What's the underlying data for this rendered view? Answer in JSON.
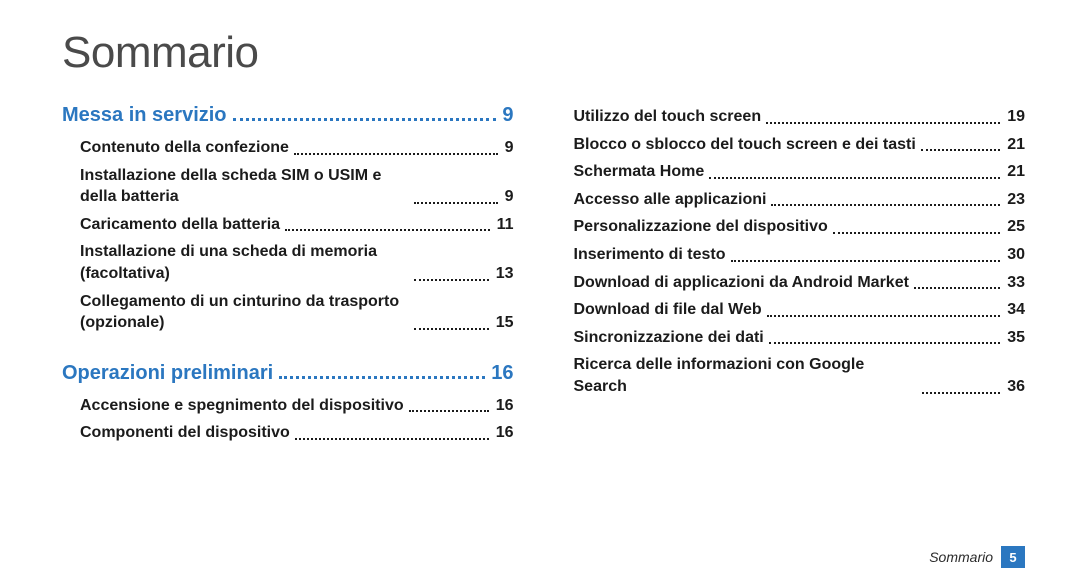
{
  "title": "Sommario",
  "sections": [
    {
      "label": "Messa in servizio",
      "page": "9"
    },
    {
      "label": "Operazioni preliminari",
      "page": "16"
    }
  ],
  "leftEntries": {
    "s0": [
      {
        "label": "Contenuto della confezione",
        "page": "9"
      },
      {
        "label": "Installazione della scheda SIM o USIM e della batteria",
        "page": "9"
      },
      {
        "label": "Caricamento della batteria",
        "page": "11"
      },
      {
        "label": "Installazione di una scheda di memoria (facoltativa)",
        "page": "13"
      },
      {
        "label": "Collegamento di un cinturino da trasporto (opzionale)",
        "page": "15"
      }
    ],
    "s1": [
      {
        "label": "Accensione e spegnimento del dispositivo",
        "page": "16"
      },
      {
        "label": "Componenti del dispositivo",
        "page": "16"
      }
    ]
  },
  "rightEntries": [
    {
      "label": "Utilizzo del touch screen",
      "page": "19"
    },
    {
      "label": "Blocco o sblocco del touch screen e dei tasti",
      "page": "21"
    },
    {
      "label": "Schermata Home",
      "page": "21"
    },
    {
      "label": "Accesso alle applicazioni",
      "page": "23"
    },
    {
      "label": "Personalizzazione del dispositivo",
      "page": "25"
    },
    {
      "label": "Inserimento di testo",
      "page": "30"
    },
    {
      "label": "Download di applicazioni da Android Market",
      "page": "33"
    },
    {
      "label": "Download di file dal Web",
      "page": "34"
    },
    {
      "label": "Sincronizzazione dei dati",
      "page": "35"
    },
    {
      "label": "Ricerca delle informazioni con Google Search",
      "page": "36"
    }
  ],
  "footer": {
    "label": "Sommario",
    "page": "5"
  }
}
